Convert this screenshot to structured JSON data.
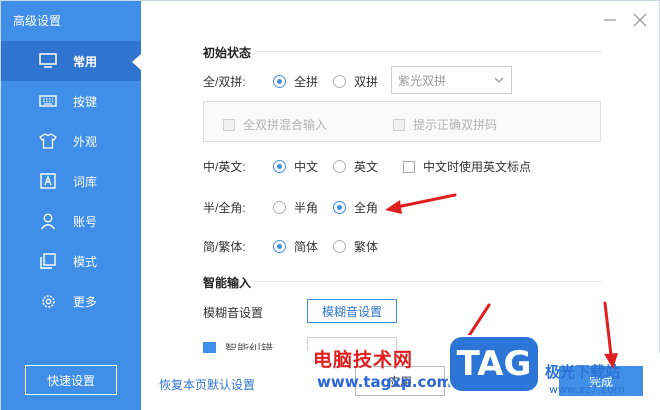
{
  "window": {
    "title": "高级设置"
  },
  "sidebar": {
    "items": [
      {
        "label": "常用",
        "icon": "monitor-icon",
        "active": true
      },
      {
        "label": "按键",
        "icon": "keyboard-icon",
        "active": false
      },
      {
        "label": "外观",
        "icon": "tshirt-icon",
        "active": false
      },
      {
        "label": "词库",
        "icon": "dictionary-icon",
        "active": false
      },
      {
        "label": "账号",
        "icon": "user-icon",
        "active": false
      },
      {
        "label": "模式",
        "icon": "mode-icon",
        "active": false
      },
      {
        "label": "更多",
        "icon": "gear-icon",
        "active": false
      }
    ],
    "quick_button": "快速设置"
  },
  "initial_state": {
    "title": "初始状态",
    "pinyin": {
      "label": "全/双拼:",
      "options": [
        "全拼",
        "双拼"
      ],
      "selected": "全拼",
      "scheme_value": "紫光双拼",
      "mixed_label": "全双拼混合输入",
      "hint_label": "提示正确双拼码"
    },
    "lang": {
      "label": "中/英文:",
      "options": [
        "中文",
        "英文"
      ],
      "selected": "中文",
      "punct_label": "中文时使用英文标点"
    },
    "width": {
      "label": "半/全角:",
      "options": [
        "半角",
        "全角"
      ],
      "selected": "全角"
    },
    "script": {
      "label": "简/繁体:",
      "options": [
        "简体",
        "繁体"
      ],
      "selected": "简体"
    }
  },
  "smart_input": {
    "title": "智能输入",
    "fuzzy_label": "模糊音设置",
    "fuzzy_button": "模糊音设置",
    "partial_label": "智能纠错"
  },
  "footer": {
    "restore_link": "恢复本页默认设置",
    "apply_button": "应用",
    "done_button": "完成"
  },
  "watermark": {
    "cn_text": "电脑技术网",
    "url_text": "www.tagxp.com",
    "tag_text": "TAG",
    "site_name": "极光下载站",
    "site_url": "www.xz7.com"
  },
  "colors": {
    "accent": "#3f8ee8",
    "accent_dark": "#2f75cf",
    "annotation_arrow": "#e02020"
  }
}
